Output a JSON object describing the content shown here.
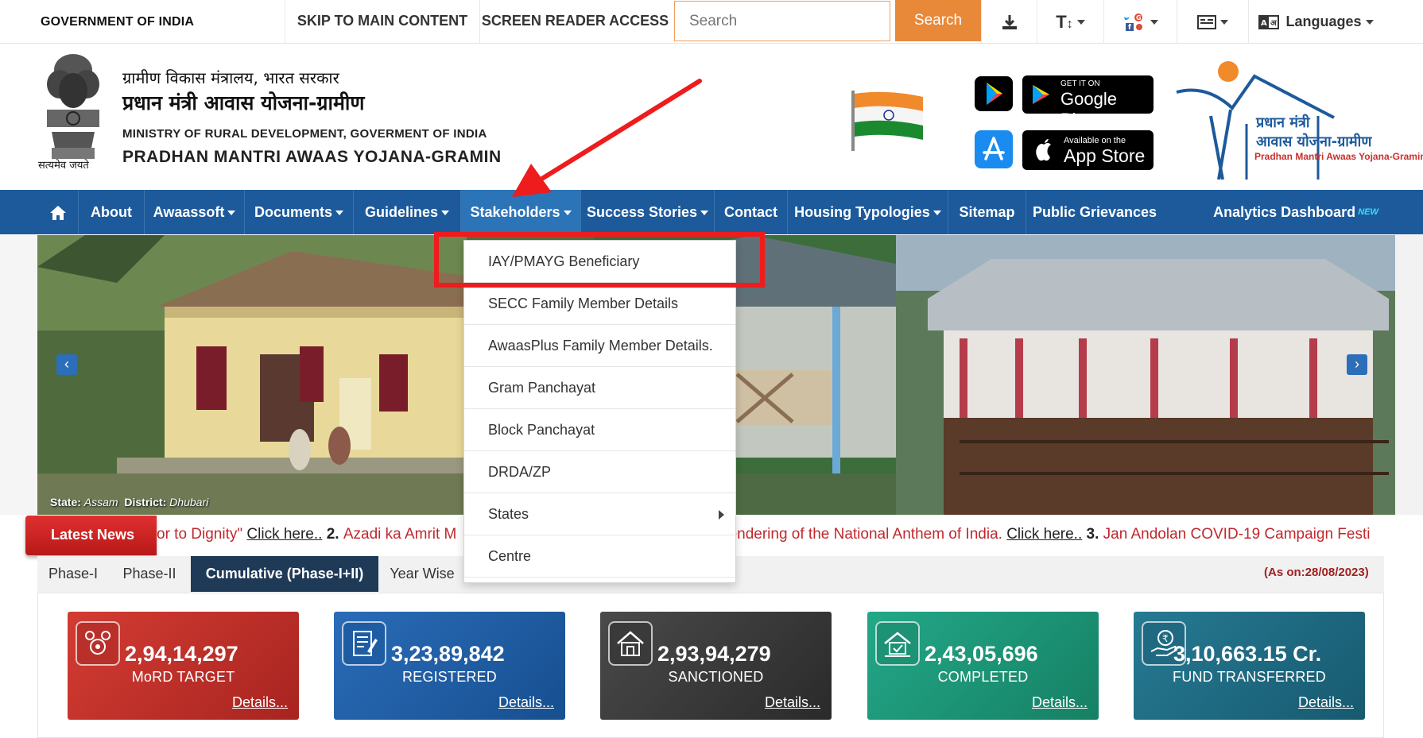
{
  "topbar": {
    "gov_label": "GOVERNMENT OF INDIA",
    "skip_label": "SKIP TO MAIN CONTENT",
    "reader_label": "SCREEN READER ACCESS",
    "search_placeholder": "Search",
    "search_button": "Search",
    "text_size_label": "T",
    "languages_label": "Languages",
    "icons": [
      "download-icon",
      "text-size-icon",
      "social-icon",
      "sitemap-icon",
      "language-icon"
    ]
  },
  "header": {
    "emblem_motto": "सत्यमेव जयते",
    "hi_ministry": "ग्रामीण विकास मंत्रालय, भारत सरकार",
    "hi_scheme": "प्रधान मंत्री आवास योजना-ग्रामीण",
    "en_ministry": "MINISTRY OF RURAL DEVELOPMENT, GOVERMENT OF INDIA",
    "en_scheme": "PRADHAN MANTRI AWAAS YOJANA-GRAMIN",
    "google_play_small": "GET IT ON",
    "google_play_big": "Google Play",
    "app_store_small": "Available on the",
    "app_store_big": "App Store",
    "logo_hi_line1": "प्रधान मंत्री",
    "logo_hi_line2": "आवास योजना-ग्रामीण",
    "logo_en": "Pradhan Mantri Awaas Yojana-Gramin"
  },
  "nav": {
    "items": [
      {
        "label": "About",
        "dropdown": false
      },
      {
        "label": "Awaassoft",
        "dropdown": true
      },
      {
        "label": "Documents",
        "dropdown": true
      },
      {
        "label": "Guidelines",
        "dropdown": true
      },
      {
        "label": "Stakeholders",
        "dropdown": true
      },
      {
        "label": "Success Stories",
        "dropdown": true
      },
      {
        "label": "Contact",
        "dropdown": false
      },
      {
        "label": "Housing Typologies",
        "dropdown": true
      },
      {
        "label": "Sitemap",
        "dropdown": false
      },
      {
        "label": "Public Grievances",
        "dropdown": false
      },
      {
        "label": "Analytics Dashboard",
        "dropdown": false
      }
    ],
    "new_badge": "NEW"
  },
  "dropdown": {
    "items": [
      "IAY/PMAYG Beneficiary",
      "SECC Family Member Details",
      "AwaasPlus Family Member Details.",
      "Gram Panchayat",
      "Block Panchayat",
      "DRDA/ZP",
      "States",
      "Centre"
    ]
  },
  "carousel": {
    "state_label": "State:",
    "state_value": "Assam",
    "district_label": "District:",
    "district_value": "Dhubari"
  },
  "news": {
    "badge": "Latest News",
    "segments": [
      {
        "text": "or to Dignity\" ",
        "kind": "text"
      },
      {
        "text": "Click here..",
        "kind": "link"
      },
      {
        "text": "  2. ",
        "kind": "num"
      },
      {
        "text": "Azadi ka Amrit M",
        "kind": "text"
      },
      {
        "text": "e rendering of the National Anthem of India. ",
        "kind": "text"
      },
      {
        "text": "Click here..",
        "kind": "link"
      },
      {
        "text": "  3. ",
        "kind": "num"
      },
      {
        "text": "Jan Andolan COVID-19 Campaign Festi",
        "kind": "text"
      }
    ]
  },
  "tabs": {
    "items": [
      "Phase-I",
      "Phase-II",
      "Cumulative (Phase-I+II)",
      "Year Wise"
    ],
    "as_on": "(As on:28/08/2023)"
  },
  "cards": [
    {
      "value": "2,94,14,297",
      "label": "MoRD TARGET",
      "link": "Details...",
      "color": "#c0322e"
    },
    {
      "value": "3,23,89,842",
      "label": "REGISTERED",
      "link": "Details...",
      "color": "#1f5fa6"
    },
    {
      "value": "2,93,94,279",
      "label": "SANCTIONED",
      "link": "Details...",
      "color": "#3b3b3b"
    },
    {
      "value": "2,43,05,696",
      "label": "COMPLETED",
      "link": "Details...",
      "color": "#1b9a7a"
    },
    {
      "value": "3,10,663.15 Cr.",
      "label": "FUND TRANSFERRED",
      "link": "Details...",
      "color": "#1f6f86"
    }
  ],
  "colors": {
    "nav": "#1d5a9c",
    "search_button": "#e8893a",
    "news_red": "#c0282d",
    "highlight": "#ee1c1c"
  }
}
